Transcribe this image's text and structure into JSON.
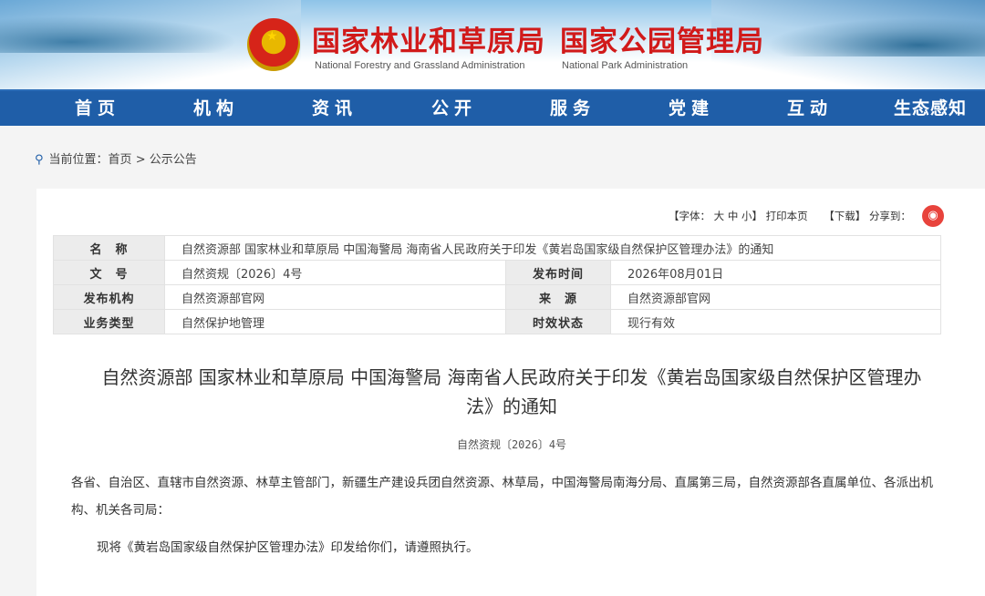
{
  "header": {
    "org1_cn": "国家林业和草原局",
    "org1_en": "National Forestry and Grassland Administration",
    "org2_cn": "国家公园管理局",
    "org2_en": "National Park Administration",
    "emblem_icon": "national-emblem-icon"
  },
  "nav": {
    "items": [
      {
        "label": "首页"
      },
      {
        "label": "机构"
      },
      {
        "label": "资讯"
      },
      {
        "label": "公开"
      },
      {
        "label": "服务"
      },
      {
        "label": "党建"
      },
      {
        "label": "互动"
      },
      {
        "label": "生态感知"
      }
    ]
  },
  "breadcrumb": {
    "prefix": "当前位置：",
    "home": "首页",
    "sep": " > ",
    "current": "公示公告"
  },
  "tools": {
    "font_label": "【字体：",
    "large": "大",
    "medium": "中",
    "small": "小",
    "font_close": "】",
    "print": "打印本页",
    "download": "【下载】",
    "share": "分享到："
  },
  "meta": {
    "name_label": "名　称",
    "name_value": "自然资源部 国家林业和草原局 中国海警局 海南省人民政府关于印发《黄岩岛国家级自然保护区管理办法》的通知",
    "docno_label": "文　号",
    "docno_value": "自然资规〔2026〕4号",
    "date_label": "发布时间",
    "date_value": "2026年08月01日",
    "issuer_label": "发布机构",
    "issuer_value": "自然资源部官网",
    "source_label": "来　源",
    "source_value": "自然资源部官网",
    "type_label": "业务类型",
    "type_value": "自然保护地管理",
    "status_label": "时效状态",
    "status_value": "现行有效"
  },
  "article": {
    "title_line1": "自然资源部 国家林业和草原局 中国海警局 海南省人民政府关于印发《黄岩岛国家级自然保护区管理办",
    "title_line2": "法》的通知",
    "docno": "自然资规〔2026〕4号",
    "para1": "各省、自治区、直辖市自然资源、林草主管部门，新疆生产建设兵团自然资源、林草局，中国海警局南海分局、直属第三局，自然资源部各直属单位、各派出机构、机关各司局：",
    "para2": "现将《黄岩岛国家级自然保护区管理办法》印发给你们，请遵照执行。"
  },
  "colors": {
    "nav_bg": "#1f5ea8",
    "logo_red": "#d11a1a"
  }
}
